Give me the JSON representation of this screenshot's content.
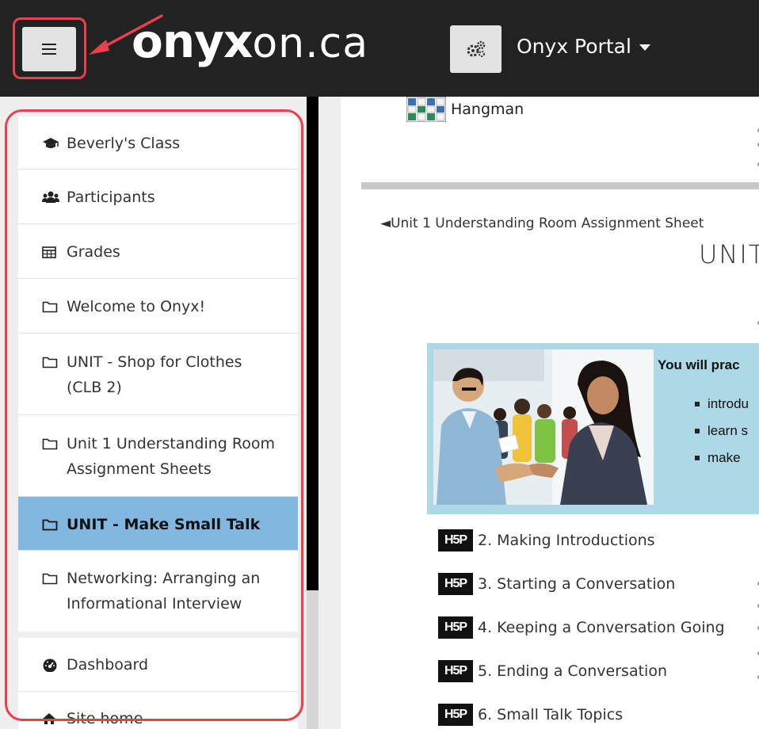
{
  "navbar": {
    "brand_bold": "onyx",
    "brand_light": "on.ca",
    "portal_label": "Onyx Portal"
  },
  "sidebar": {
    "items": [
      {
        "label": "Beverly's Class",
        "icon": "graduation-cap-icon"
      },
      {
        "label": "Participants",
        "icon": "users-icon"
      },
      {
        "label": "Grades",
        "icon": "table-icon"
      },
      {
        "label": "Welcome to Onyx!",
        "icon": "folder-icon"
      },
      {
        "label": "UNIT - Shop for Clothes (CLB 2)",
        "icon": "folder-icon"
      },
      {
        "label": "Unit 1 Understanding Room Assignment Sheets",
        "icon": "folder-icon"
      },
      {
        "label": "UNIT - Make Small Talk",
        "icon": "folder-icon",
        "active": true
      },
      {
        "label": "Networking: Arranging an Informational Interview",
        "icon": "folder-icon"
      }
    ],
    "footer_items": [
      {
        "label": "Dashboard",
        "icon": "dashboard-icon"
      },
      {
        "label": "Site home",
        "icon": "home-icon"
      }
    ]
  },
  "main": {
    "hangman_label": "Hangman",
    "prev_section": "◄Unit 1 Understanding Room Assignment Sheet",
    "unit_title": "UNIT",
    "intro": {
      "heading": "You will prac",
      "bullets": [
        "introdu",
        "learn s",
        "make"
      ]
    },
    "activities": [
      {
        "badge": "H5P",
        "label": "2. Making Introductions"
      },
      {
        "badge": "H5P",
        "label": "3. Starting a Conversation"
      },
      {
        "badge": "H5P",
        "label": "4. Keeping a Conversation Going"
      },
      {
        "badge": "H5P",
        "label": "5. Ending a Conversation"
      },
      {
        "badge": "H5P",
        "label": "6. Small Talk Topics"
      }
    ]
  },
  "colors": {
    "navbar": "#222222",
    "active_item": "#82b8e0",
    "highlight": "#e8414b",
    "intro_box": "#add8e6"
  }
}
